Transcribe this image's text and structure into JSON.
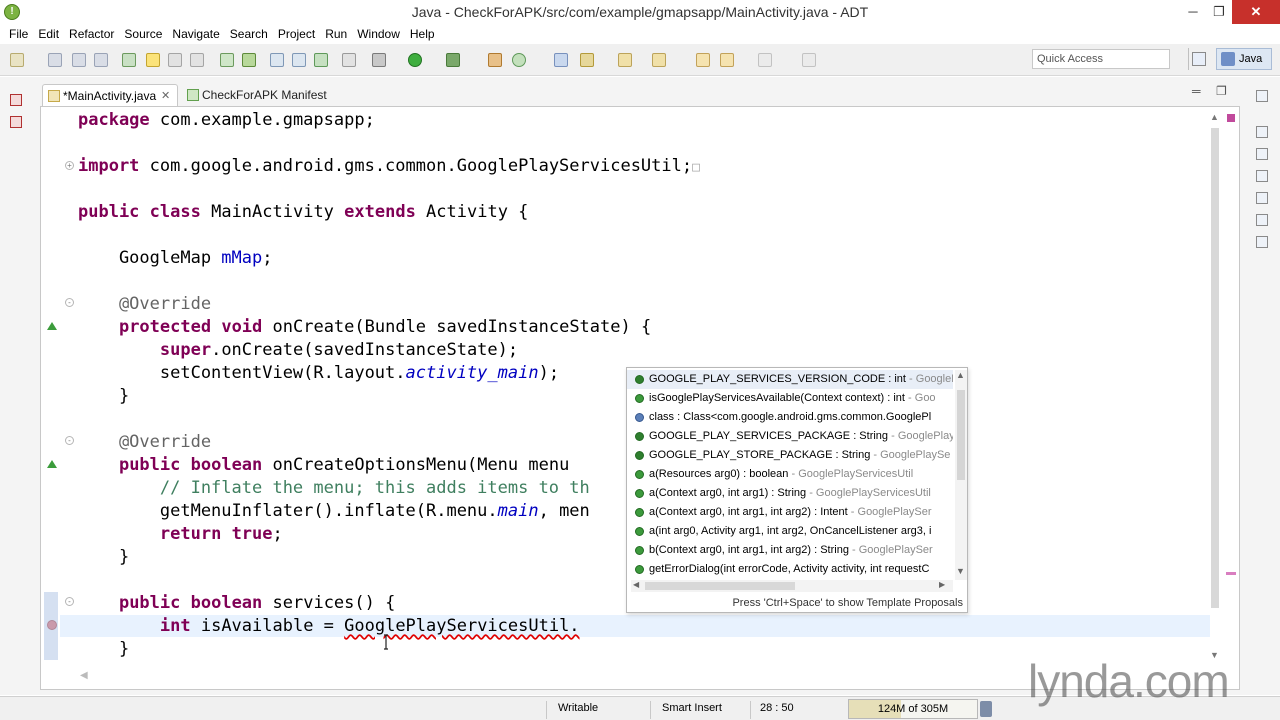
{
  "window": {
    "title": "Java - CheckForAPK/src/com/example/gmapsapp/MainActivity.java - ADT",
    "min": "─",
    "max": "❐",
    "close": "✕"
  },
  "menu": [
    "File",
    "Edit",
    "Refactor",
    "Source",
    "Navigate",
    "Search",
    "Project",
    "Run",
    "Window",
    "Help"
  ],
  "toolbar": {
    "quick_access_placeholder": "Quick Access",
    "perspective": "Java"
  },
  "tabs": {
    "active": "*MainActivity.java",
    "active_close": "✕",
    "inactive": "CheckForAPK Manifest"
  },
  "editor_controls": {
    "minimize": "═",
    "maximize": "❐"
  },
  "code": {
    "l1_kw": "package",
    "l1_rest": " com.example.gmapsapp;",
    "l2_kw": "import",
    "l2_rest": " com.google.android.gms.common.GooglePlayServicesUtil;",
    "l2_fold": "□",
    "l3_kw1": "public",
    "l3_kw2": "class",
    "l3_name": " MainActivity ",
    "l3_kw3": "extends",
    "l3_rest": " Activity {",
    "l4_type": "    GoogleMap ",
    "l4_field": "mMap",
    "l4_end": ";",
    "l5_ann": "    @Override",
    "l6_kw1": "protected",
    "l6_kw2": "void",
    "l6_rest": " onCreate(Bundle savedInstanceState) {",
    "l7_kw": "super",
    "l7_rest": ".onCreate(savedInstanceState);",
    "l8_a": "        setContentView(R.layout.",
    "l8_field": "activity_main",
    "l8_b": ");",
    "l9": "    }",
    "l10_ann": "    @Override",
    "l11_kw1": "public",
    "l11_kw2": "boolean",
    "l11_rest": " onCreateOptionsMenu(Menu menu",
    "l12_cmt": "        // Inflate the menu; this adds items to th",
    "l13_a": "        getMenuInflater().inflate(R.menu.",
    "l13_field": "main",
    "l13_b": ", men",
    "l14_kw": "return",
    "l14_kw2": "true",
    "l14_end": ";",
    "l15": "    }",
    "l16_kw1": "public",
    "l16_kw2": "boolean",
    "l16_rest": " services() {",
    "l17_kw": "int",
    "l17_a": " isAvailable = ",
    "l17_err": "GooglePlayServicesUtil.",
    "l18": "    }"
  },
  "assist": {
    "proposals": [
      {
        "main": "GOOGLE_PLAY_SERVICES_VERSION_CODE : int",
        "sub": " - GooglePl",
        "icon": "static"
      },
      {
        "main": "isGooglePlayServicesAvailable(Context context) : int",
        "sub": " - Goo",
        "icon": "method"
      },
      {
        "main": "class : Class<com.google.android.gms.common.GooglePl",
        "sub": "",
        "icon": "cls"
      },
      {
        "main": "GOOGLE_PLAY_SERVICES_PACKAGE : String",
        "sub": " - GooglePlay",
        "icon": "static"
      },
      {
        "main": "GOOGLE_PLAY_STORE_PACKAGE : String",
        "sub": " - GooglePlaySe",
        "icon": "static"
      },
      {
        "main": "a(Resources arg0) : boolean",
        "sub": " - GooglePlayServicesUtil",
        "icon": "method"
      },
      {
        "main": "a(Context arg0, int arg1) : String",
        "sub": " - GooglePlayServicesUtil",
        "icon": "method"
      },
      {
        "main": "a(Context arg0, int arg1, int arg2) : Intent",
        "sub": " - GooglePlaySer",
        "icon": "method"
      },
      {
        "main": "a(int arg0, Activity arg1, int arg2, OnCancelListener arg3, i",
        "sub": "",
        "icon": "method"
      },
      {
        "main": "b(Context arg0, int arg1, int arg2) : String",
        "sub": " - GooglePlaySer",
        "icon": "method"
      },
      {
        "main": "getErrorDialog(int errorCode, Activity activity, int requestC",
        "sub": "",
        "icon": "method"
      }
    ],
    "footer": "Press 'Ctrl+Space' to show Template Proposals",
    "scroll_up": "▲",
    "scroll_down": "▼",
    "scroll_left": "◀",
    "scroll_right": "▶"
  },
  "status": {
    "writable": "Writable",
    "insert_mode": "Smart Insert",
    "position": "28 : 50",
    "heap": "124M of 305M",
    "heap_used_fraction": 0.41
  },
  "watermark": "lynda.com"
}
